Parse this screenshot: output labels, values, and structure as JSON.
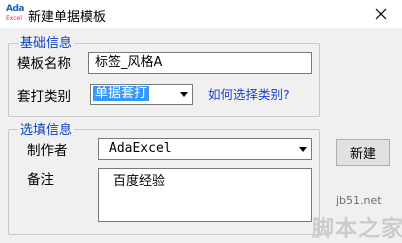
{
  "window": {
    "title": "新建单据模板",
    "app_icon_text_top": "Ada",
    "app_icon_text_bottom": "Excel",
    "close_icon": "close-x-icon"
  },
  "basic_info": {
    "legend": "基础信息",
    "template_name_label": "模板名称",
    "template_name_value": "标签_风格A",
    "category_label": "套打类别",
    "category_value": "单据套打",
    "help_link": "如何选择类别?"
  },
  "options": {
    "legend": "选填信息",
    "author_label": "制作者",
    "author_value": "AdaExcel",
    "note_label": "备注",
    "note_value": "百度经验"
  },
  "actions": {
    "new_button_label": "新建"
  },
  "watermark": {
    "line1": "jb51.net",
    "line2": "脚本之家"
  },
  "colors": {
    "legend": "#0a3fbf",
    "link": "#1a3fd6",
    "selection": "#3399ff",
    "background": "#f0f0f0"
  }
}
